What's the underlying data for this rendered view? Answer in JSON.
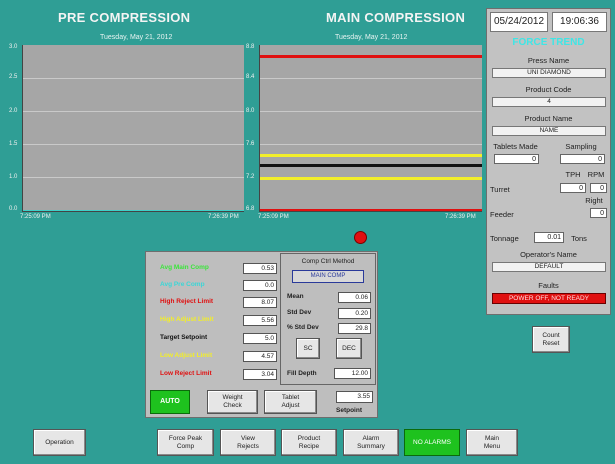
{
  "pre_compression": {
    "title": "PRE COMPRESSION",
    "date_caption": "Tuesday, May 21, 2012",
    "y_ticks": [
      "3.0",
      "2.5",
      "2.0",
      "1.5",
      "1.0",
      "0.5",
      "0.0"
    ],
    "x_start": "7:25:09 PM",
    "x_end": "7:26:39 PM"
  },
  "main_compression": {
    "title": "MAIN COMPRESSION",
    "date_caption": "Tuesday, May 21, 2012",
    "y_ticks": [
      "8.8",
      "8.4",
      "8.0",
      "7.6",
      "7.2",
      "6.8"
    ],
    "x_start": "7:25:09 PM",
    "x_end": "7:26:39 PM",
    "line_colors": {
      "red": "#e01010",
      "yellow": "#f2ee2a",
      "black": "#111111"
    }
  },
  "chart_data": [
    {
      "type": "line",
      "title": "PRE COMPRESSION",
      "x": [
        "7:25:09 PM",
        "7:26:39 PM"
      ],
      "ylim": [
        0.0,
        3.0
      ],
      "series": []
    },
    {
      "type": "line",
      "title": "MAIN COMPRESSION",
      "x": [
        "7:25:09 PM",
        "7:26:39 PM"
      ],
      "ylim": [
        6.8,
        8.8
      ],
      "series": [
        {
          "values": [
            8.67,
            8.67
          ],
          "color": "#e01010"
        },
        {
          "values": [
            7.48,
            7.48
          ],
          "color": "#f2ee2a"
        },
        {
          "values": [
            7.36,
            7.36
          ],
          "color": "#111111"
        },
        {
          "values": [
            7.21,
            7.21
          ],
          "color": "#f2ee2a"
        },
        {
          "values": [
            6.8,
            6.8
          ],
          "color": "#e01010"
        }
      ]
    }
  ],
  "right_panel": {
    "date": "05/24/2012",
    "time": "19:06:36",
    "force_trend": "FORCE TREND",
    "press_name_label": "Press Name",
    "press_name": "UNI DIAMOND",
    "product_code_label": "Product Code",
    "product_code": "4",
    "product_name_label": "Product Name",
    "product_name": "NAME",
    "tablets_made_label": "Tablets Made",
    "tablets_made": "0",
    "sampling_label": "Sampling",
    "sampling": "0",
    "tph_label": "TPH",
    "rpm_label": "RPM",
    "turret_label": "Turret",
    "turret_tph": "0",
    "turret_rpm": "0",
    "right_label": "Right",
    "feeder_label": "Feeder",
    "feeder_right": "0",
    "tonnage_label": "Tonnage",
    "tonnage": "0.01",
    "tons_label": "Tons",
    "operator_label": "Operator's Name",
    "operator": "DEFAULT",
    "faults_label": "Faults",
    "fault_text": "POWER OFF, NOT READY",
    "count_reset": "Count Reset"
  },
  "control": {
    "avg_main_comp": {
      "label": "Avg Main Comp",
      "value": "0.53"
    },
    "avg_pre_comp": {
      "label": "Avg Pre Comp",
      "value": "0.0"
    },
    "high_reject": {
      "label": "High Reject Limit",
      "value": "8.07"
    },
    "high_adjust": {
      "label": "High Adjust Limit",
      "value": "5.56"
    },
    "target": {
      "label": "Target Setpoint",
      "value": "5.0"
    },
    "low_adjust": {
      "label": "Low Adjust Limit",
      "value": "4.57"
    },
    "low_reject": {
      "label": "Low Reject Limit",
      "value": "3.04"
    },
    "comp_ctrl_title": "Comp Ctrl Method",
    "comp_ctrl_value": "MAIN COMP",
    "mean_label": "Mean",
    "mean_value": "0.06",
    "std_label": "Std Dev",
    "std_value": "0.20",
    "pct_std_label": "% Std Dev",
    "pct_std_value": "29.8",
    "fill_depth_label": "Fill Depth",
    "fill_depth_value": "12.00",
    "setpoint_value": "3.55",
    "setpoint_label": "Setpoint",
    "auto_label": "AUTO",
    "weight_check": "Weight Check",
    "tablet_adjust": "Tablet Adjust",
    "small_btn1": "SC",
    "small_btn2": "DEC"
  },
  "bottom_nav": {
    "operation": "Operation",
    "force_peak": "Force Peak Comp",
    "view_rejects": "View Rejects",
    "product_recipe": "Product Recipe",
    "alarm_summary": "Alarm Summary",
    "no_alarms": "NO ALARMS",
    "main_menu": "Main Menu"
  }
}
